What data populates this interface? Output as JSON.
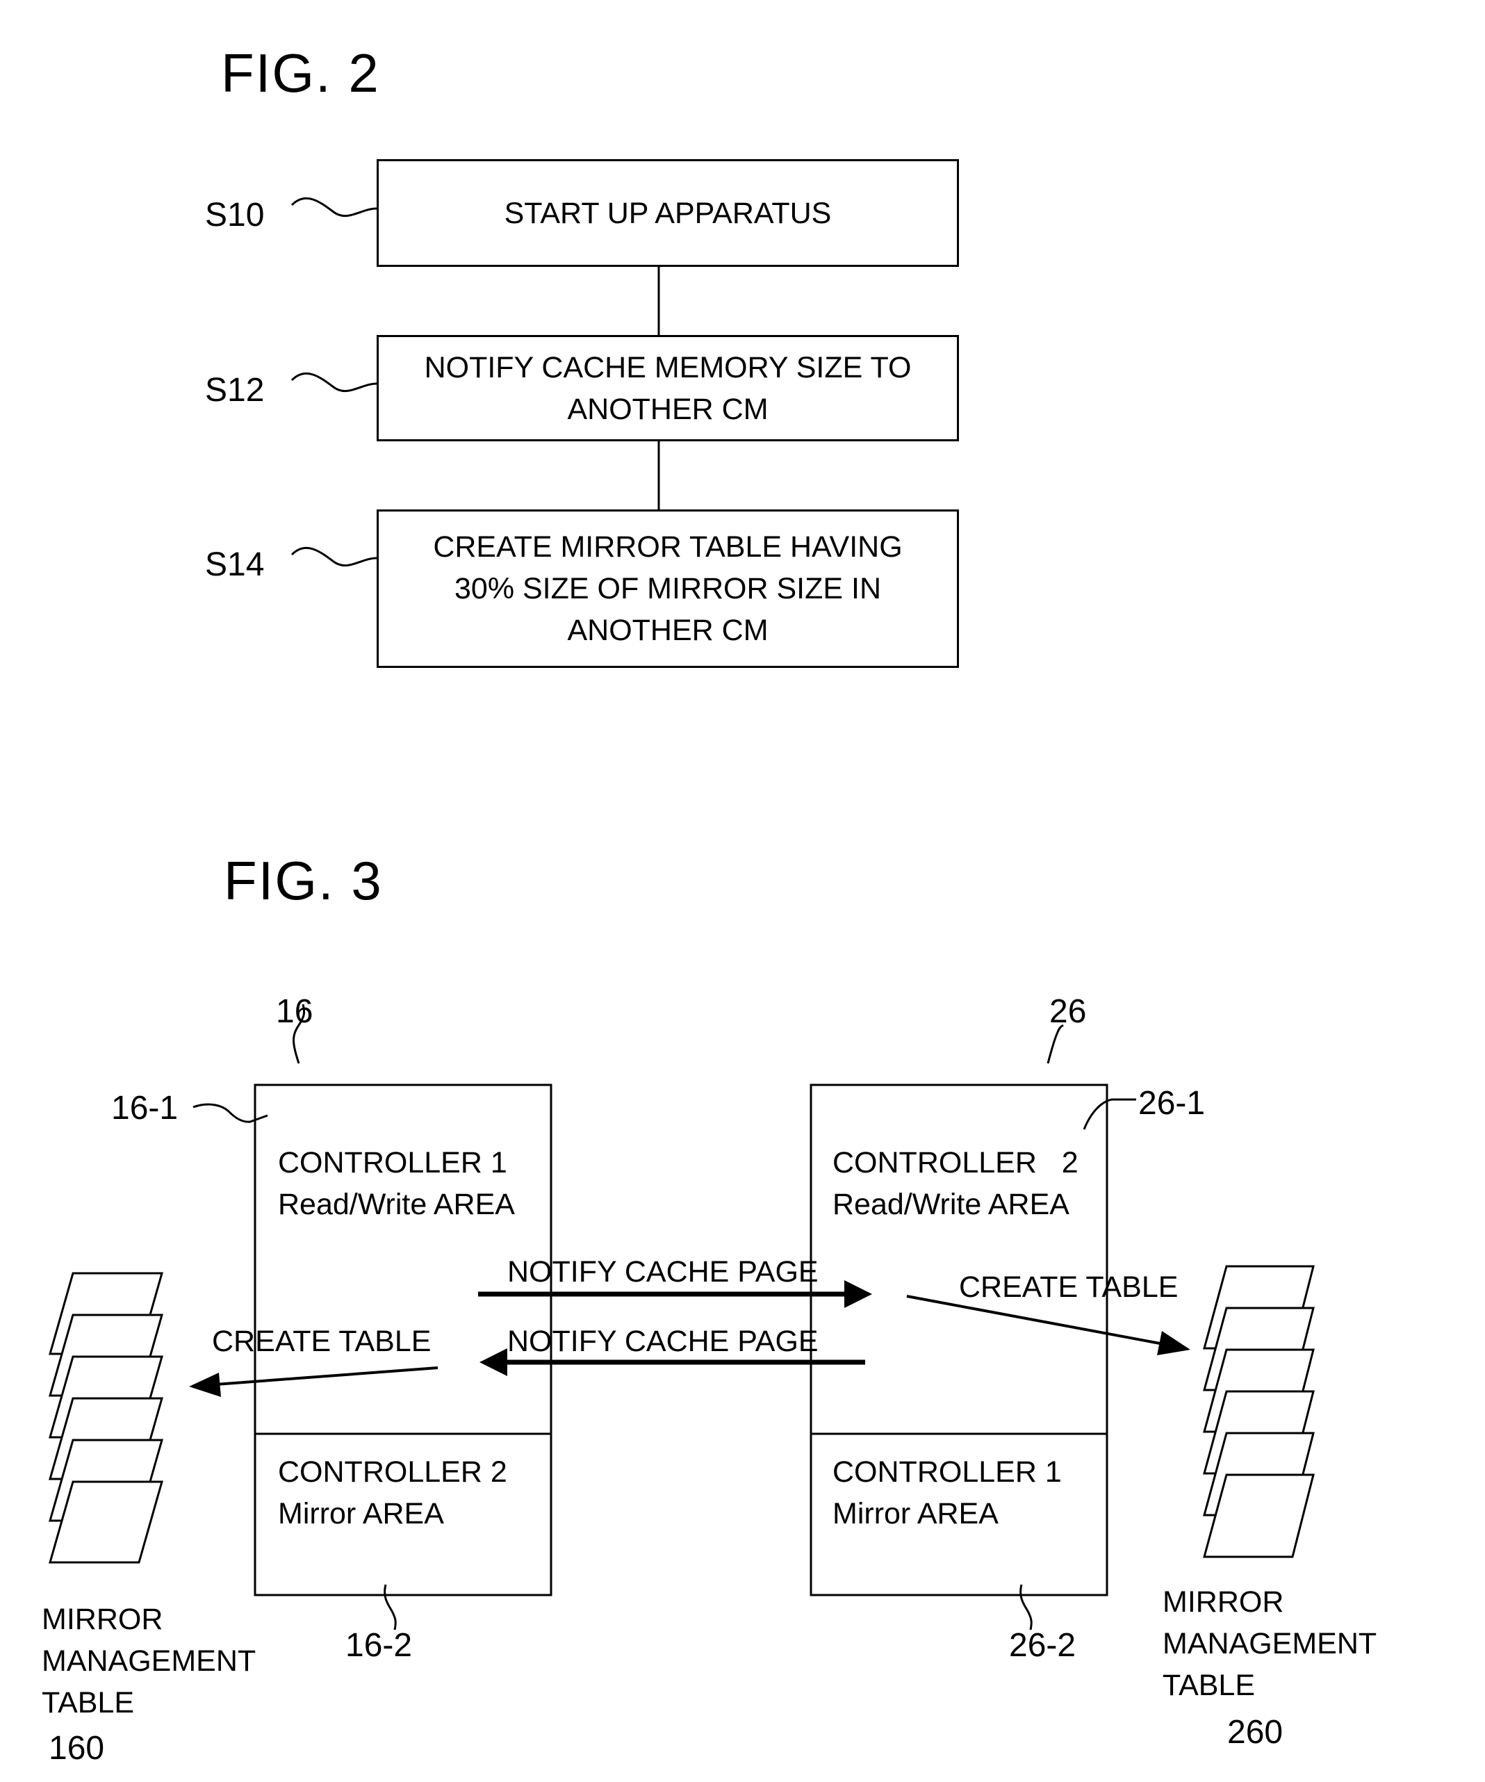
{
  "fig2": {
    "title": "FIG. 2",
    "steps": [
      {
        "id": "S10",
        "text": "START UP APPARATUS"
      },
      {
        "id": "S12",
        "text": "NOTIFY CACHE MEMORY SIZE TO ANOTHER CM"
      },
      {
        "id": "S14",
        "text": "CREATE MIRROR TABLE HAVING 30% SIZE OF MIRROR SIZE IN ANOTHER CM"
      }
    ]
  },
  "fig3": {
    "title": "FIG. 3",
    "left": {
      "ref": "16",
      "top_ref": "16-1",
      "bottom_ref": "16-2",
      "top_line1": "CONTROLLER 1",
      "top_line2": "Read/Write AREA",
      "bottom_line1": "CONTROLLER 2",
      "bottom_line2": "Mirror AREA",
      "table_label": [
        "MIRROR",
        "MANAGEMENT",
        "TABLE"
      ],
      "table_ref": "160",
      "create_label": "CREATE TABLE"
    },
    "right": {
      "ref": "26",
      "top_ref": "26-1",
      "bottom_ref": "26-2",
      "top_line1": "CONTROLLER   2",
      "top_line2": "Read/Write AREA",
      "bottom_line1": "CONTROLLER 1",
      "bottom_line2": "Mirror AREA",
      "table_label": [
        "MIRROR",
        "MANAGEMENT",
        "TABLE"
      ],
      "table_ref": "260",
      "create_label": "CREATE TABLE"
    },
    "notify_right": "NOTIFY CACHE PAGE",
    "notify_left": "NOTIFY CACHE PAGE"
  }
}
